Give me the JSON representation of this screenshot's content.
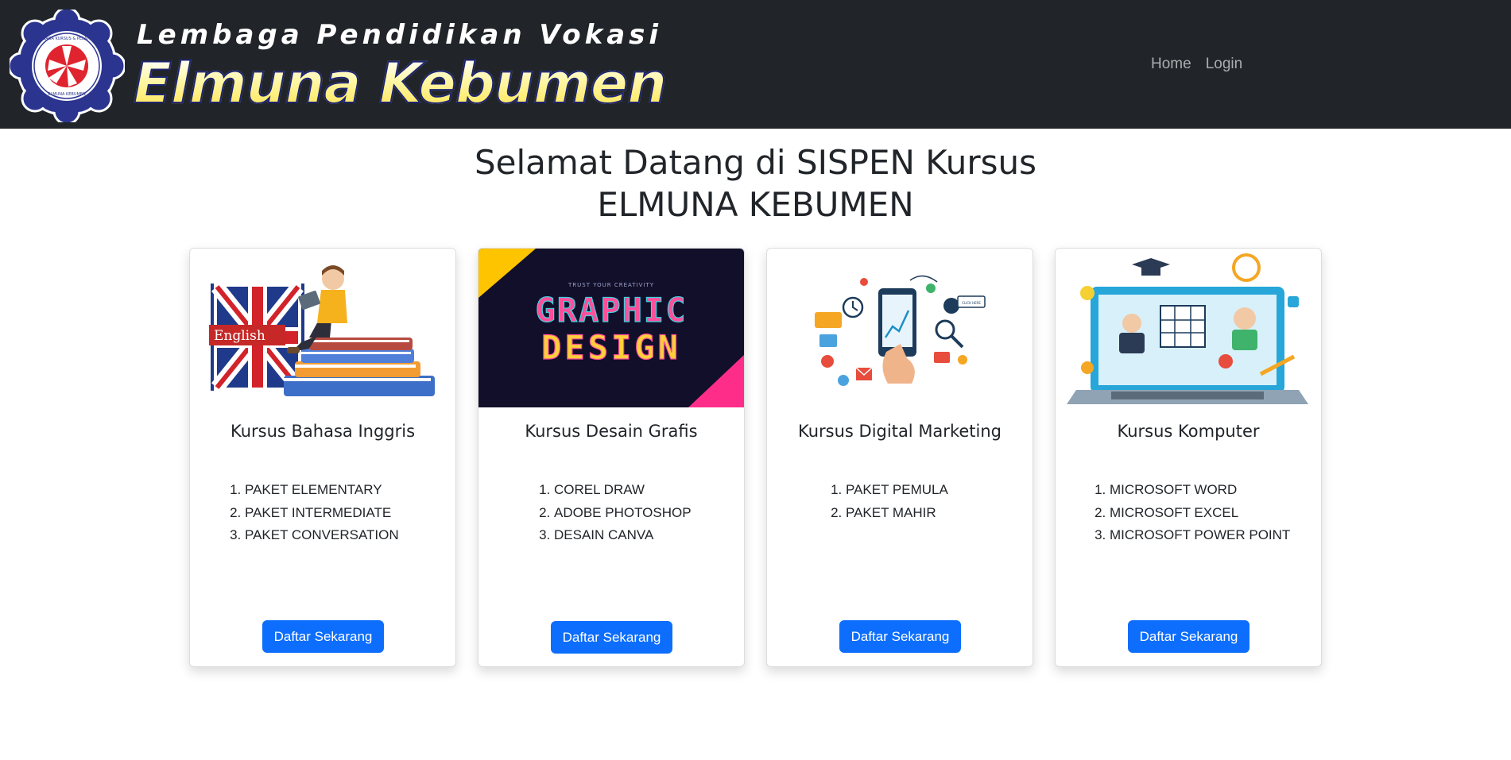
{
  "navbar": {
    "brand_subtitle": "Lembaga Pendidikan Vokasi",
    "brand_title": "Elmuna Kebumen",
    "seal_top_text": "LEMBAGA KURSUS & PELATIHAN",
    "seal_bottom_text": "ELMUNA KEBUMEN",
    "links": [
      "Home",
      "Login"
    ]
  },
  "hero": {
    "line1": "Selamat Datang di SISPEN Kursus",
    "line2": "ELMUNA KEBUMEN"
  },
  "cards": [
    {
      "title": "Kursus Bahasa Inggris",
      "image_label": "English",
      "items": [
        "PAKET ELEMENTARY",
        "PAKET INTERMEDIATE",
        "PAKET CONVERSATION"
      ],
      "button": "Daftar Sekarang"
    },
    {
      "title": "Kursus Desain Grafis",
      "image_label_small": "TRUST YOUR CREATIVITY",
      "image_label_1": "GRAPHIC",
      "image_label_2": "DESIGN",
      "items": [
        "COREL DRAW",
        "ADOBE PHOTOSHOP",
        "DESAIN CANVA"
      ],
      "button": "Daftar Sekarang"
    },
    {
      "title": "Kursus Digital Marketing",
      "image_label": "CLICK HERE",
      "items": [
        "PAKET PEMULA",
        "PAKET MAHIR"
      ],
      "button": "Daftar Sekarang"
    },
    {
      "title": "Kursus Komputer",
      "items": [
        "MICROSOFT WORD",
        "MICROSOFT EXCEL",
        "MICROSOFT POWER POINT"
      ],
      "button": "Daftar Sekarang"
    }
  ],
  "colors": {
    "navbar_bg": "#212529",
    "primary_button": "#0d6efd",
    "seal_blue": "#2b3590",
    "seal_red": "#e0242f",
    "design_bg": "#120f2a",
    "design_yellow": "#ffc400",
    "design_pink": "#ff2d8a"
  }
}
